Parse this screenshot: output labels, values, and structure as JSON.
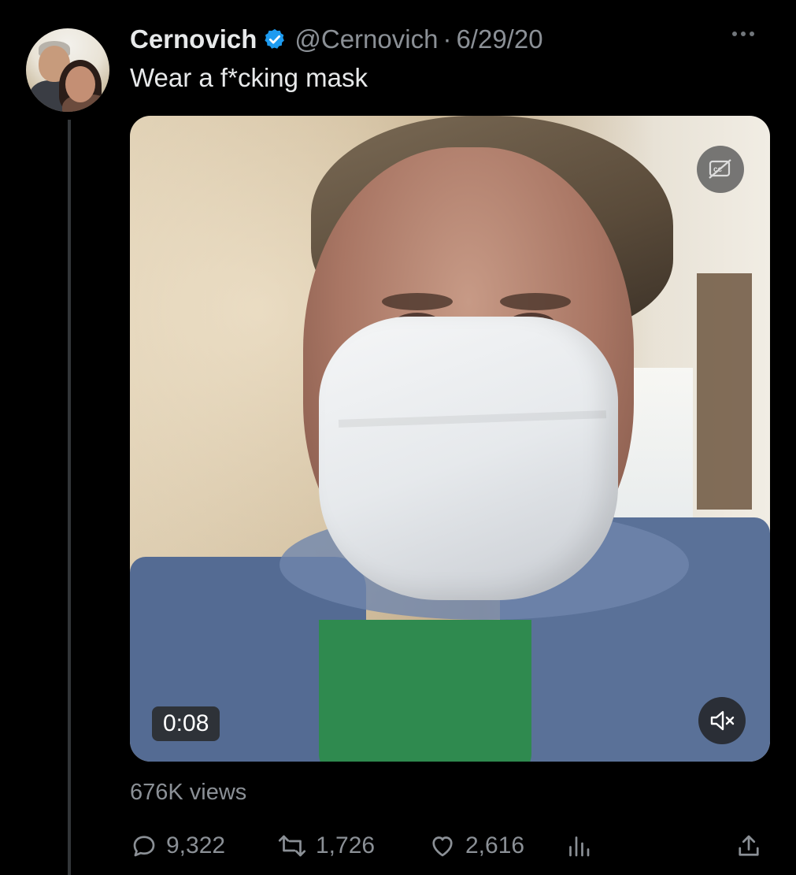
{
  "tweet": {
    "author_name": "Cernovich",
    "author_handle": "@Cernovich",
    "separator": "·",
    "date": "6/29/20",
    "text": "Wear a f*cking mask",
    "video_time": "0:08",
    "views": "676K views",
    "stats": {
      "replies": "9,322",
      "retweets": "1,726",
      "likes": "2,616"
    }
  },
  "icons": {
    "verified": "verified-badge-icon",
    "more": "more-icon",
    "captions": "captions-off-icon",
    "mute": "muted-speaker-icon",
    "reply": "reply-icon",
    "retweet": "retweet-icon",
    "like": "heart-icon",
    "analytics": "analytics-icon",
    "share": "share-icon"
  },
  "colors": {
    "background": "#000000",
    "text_primary": "#e7e9ea",
    "text_secondary": "#8b9096",
    "verified": "#1d9bf0"
  }
}
